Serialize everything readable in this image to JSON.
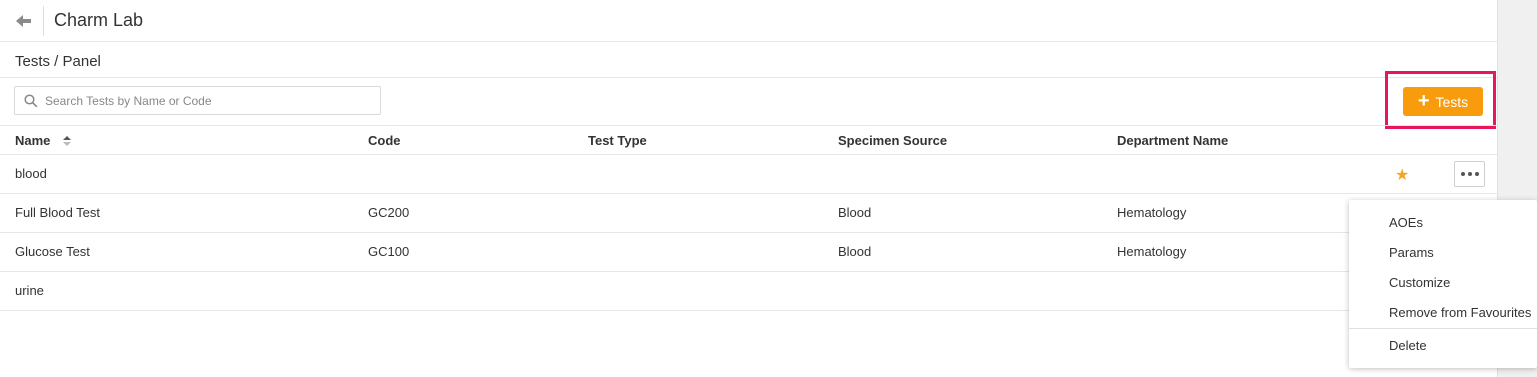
{
  "header": {
    "title": "Charm Lab"
  },
  "breadcrumb": "Tests / Panel",
  "search": {
    "placeholder": "Search Tests by Name or Code",
    "value": ""
  },
  "add_button": {
    "label": "Tests"
  },
  "table": {
    "columns": [
      "Name",
      "Code",
      "Test Type",
      "Specimen Source",
      "Department Name"
    ],
    "sort_column": "Name",
    "rows": [
      {
        "name": "blood",
        "code": "",
        "test_type": "",
        "specimen": "",
        "department": "",
        "favourite": true
      },
      {
        "name": "Full Blood Test",
        "code": "GC200",
        "test_type": "",
        "specimen": "Blood",
        "department": "Hematology",
        "favourite": false
      },
      {
        "name": "Glucose Test",
        "code": "GC100",
        "test_type": "",
        "specimen": "Blood",
        "department": "Hematology",
        "favourite": false
      },
      {
        "name": "urine",
        "code": "",
        "test_type": "",
        "specimen": "",
        "department": "",
        "favourite": false
      }
    ]
  },
  "context_menu": {
    "items": [
      "AOEs",
      "Params",
      "Customize",
      "Remove from Favourites",
      "Delete"
    ]
  },
  "colors": {
    "accent": "#f89c0e",
    "highlight": "#e8175d",
    "star": "#f5a623"
  }
}
